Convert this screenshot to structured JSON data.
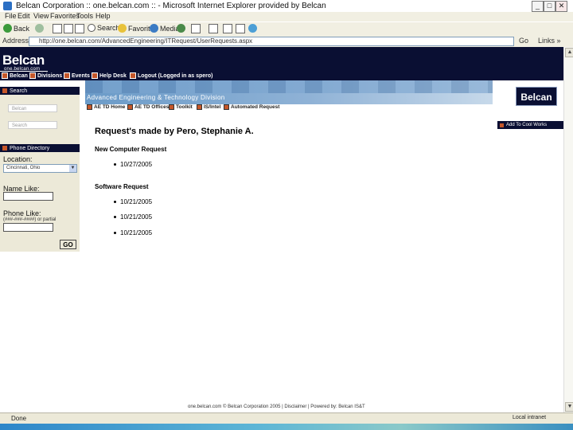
{
  "window": {
    "title": "Belcan Corporation :: one.belcan.com :: - Microsoft Internet Explorer provided by Belcan",
    "controls": [
      "_",
      "□",
      "✕"
    ]
  },
  "menubar": [
    "File",
    "Edit",
    "View",
    "Favorites",
    "Tools",
    "Help"
  ],
  "toolbar": {
    "back": "Back",
    "search": "Search",
    "favorites": "Favorites",
    "media": "Media"
  },
  "addressbar": {
    "label": "Address",
    "url": "http://one.belcan.com/AdvancedEngineering/ITRequest/UserRequests.aspx",
    "go": "Go",
    "links": "Links »"
  },
  "site": {
    "brand": "Belcan",
    "tagline": "one.belcan.com",
    "nav": [
      {
        "label": "Belcan"
      },
      {
        "label": "Divisions"
      },
      {
        "label": "Events"
      },
      {
        "label": "Help Desk"
      },
      {
        "label": "Logout (Logged in as spero)"
      }
    ]
  },
  "sidebar": {
    "search_head": "Search",
    "search_placeholder_1": "Belcan",
    "search_placeholder_2": "Search",
    "phone_head": "Phone Directory",
    "location_label": "Location:",
    "location_value": "Cincinnati, Ohio",
    "name_label": "Name Like:",
    "phone_label": "Phone Like:",
    "phone_hint": "(###-###-####) or partial",
    "go_button": "GO"
  },
  "division": {
    "title": "Advanced Engineering & Technology Division",
    "nav": [
      {
        "label": "AE TD Home"
      },
      {
        "label": "AE TD Offices"
      },
      {
        "label": "Toolkit"
      },
      {
        "label": "IS/Intel"
      },
      {
        "label": "Automated Request"
      }
    ]
  },
  "right": {
    "logo": "Belcan",
    "cool_works": "Add To Cool Works"
  },
  "main": {
    "heading": "Request's made by Pero, Stephanie A.",
    "sections": [
      {
        "title": "New Computer Request",
        "items": [
          "10/27/2005"
        ]
      },
      {
        "title": "Software Request",
        "items": [
          "10/21/2005",
          "10/21/2005",
          "10/21/2005"
        ]
      }
    ]
  },
  "footer": "one.belcan.com © Belcan Corporation 2005 | Disclaimer | Powered by: Belcan IS&T",
  "status": {
    "text": "Done",
    "zone": "Local intranet"
  },
  "colors": {
    "header_navy": "#0a0f33",
    "accent_orange": "#c5572a",
    "banner_blue": "#6b9bc8"
  }
}
